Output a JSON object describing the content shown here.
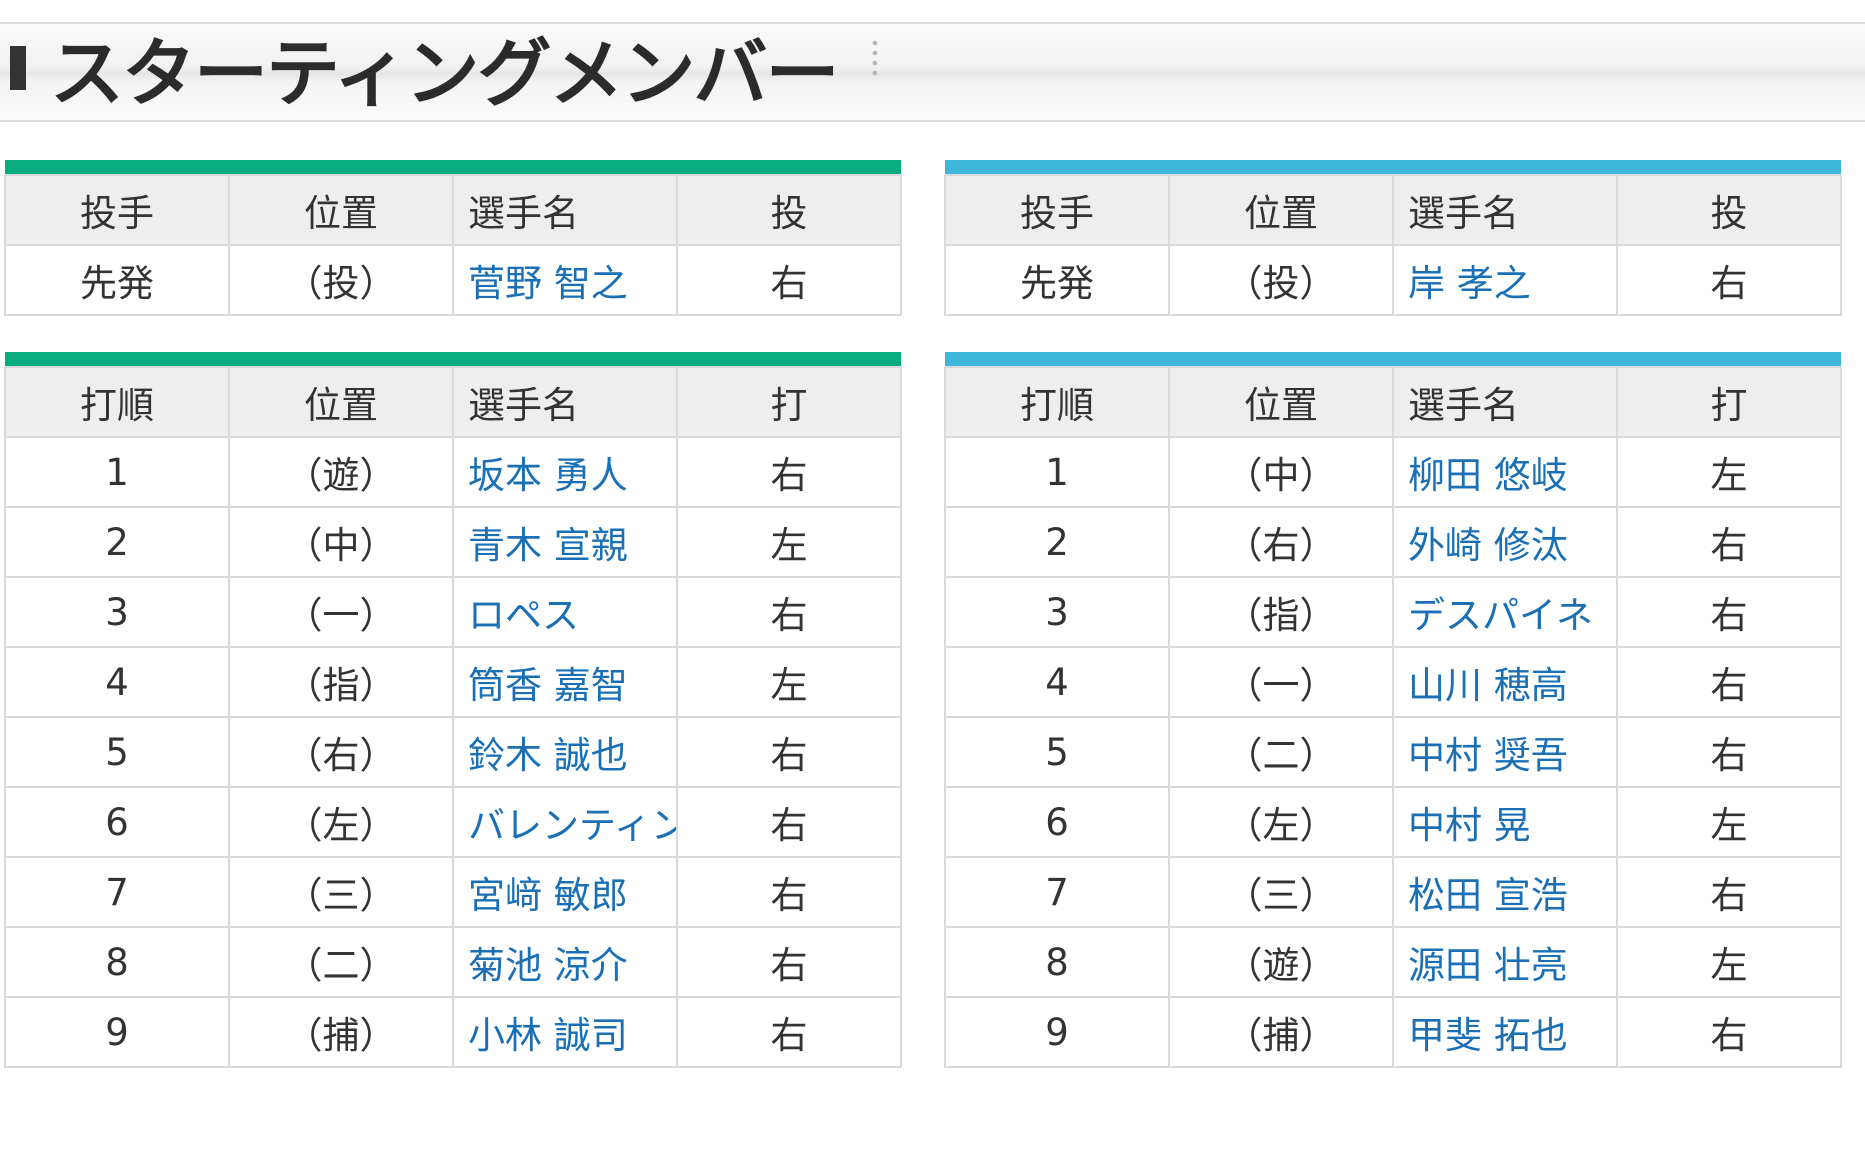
{
  "header": {
    "title": "スターティングメンバー"
  },
  "colors": {
    "left_accent": "#0aae7e",
    "right_accent": "#3fb7dc",
    "name_link": "#1a6fb5"
  },
  "left_team": {
    "pitcher_table": {
      "headers": [
        "投手",
        "位置",
        "選手名",
        "投"
      ],
      "row": {
        "order": "先発",
        "pos": "（投）",
        "name": "菅野 智之",
        "hand": "右"
      }
    },
    "batting_table": {
      "headers": [
        "打順",
        "位置",
        "選手名",
        "打"
      ],
      "rows": [
        {
          "order": "1",
          "pos": "（遊）",
          "name": "坂本 勇人",
          "hand": "右"
        },
        {
          "order": "2",
          "pos": "（中）",
          "name": "青木 宣親",
          "hand": "左"
        },
        {
          "order": "3",
          "pos": "（一）",
          "name": "ロペス",
          "hand": "右"
        },
        {
          "order": "4",
          "pos": "（指）",
          "name": "筒香 嘉智",
          "hand": "左"
        },
        {
          "order": "5",
          "pos": "（右）",
          "name": "鈴木 誠也",
          "hand": "右"
        },
        {
          "order": "6",
          "pos": "（左）",
          "name": "バレンティン",
          "hand": "右"
        },
        {
          "order": "7",
          "pos": "（三）",
          "name": "宮﨑 敏郎",
          "hand": "右"
        },
        {
          "order": "8",
          "pos": "（二）",
          "name": "菊池 涼介",
          "hand": "右"
        },
        {
          "order": "9",
          "pos": "（捕）",
          "name": "小林 誠司",
          "hand": "右"
        }
      ]
    }
  },
  "right_team": {
    "pitcher_table": {
      "headers": [
        "投手",
        "位置",
        "選手名",
        "投"
      ],
      "row": {
        "order": "先発",
        "pos": "（投）",
        "name": "岸 孝之",
        "hand": "右"
      }
    },
    "batting_table": {
      "headers": [
        "打順",
        "位置",
        "選手名",
        "打"
      ],
      "rows": [
        {
          "order": "1",
          "pos": "（中）",
          "name": "柳田 悠岐",
          "hand": "左"
        },
        {
          "order": "2",
          "pos": "（右）",
          "name": "外崎 修汰",
          "hand": "右"
        },
        {
          "order": "3",
          "pos": "（指）",
          "name": "デスパイネ",
          "hand": "右"
        },
        {
          "order": "4",
          "pos": "（一）",
          "name": "山川 穂高",
          "hand": "右"
        },
        {
          "order": "5",
          "pos": "（二）",
          "name": "中村 奨吾",
          "hand": "右"
        },
        {
          "order": "6",
          "pos": "（左）",
          "name": "中村 晃",
          "hand": "左"
        },
        {
          "order": "7",
          "pos": "（三）",
          "name": "松田 宣浩",
          "hand": "右"
        },
        {
          "order": "8",
          "pos": "（遊）",
          "name": "源田 壮亮",
          "hand": "左"
        },
        {
          "order": "9",
          "pos": "（捕）",
          "name": "甲斐 拓也",
          "hand": "右"
        }
      ]
    }
  }
}
